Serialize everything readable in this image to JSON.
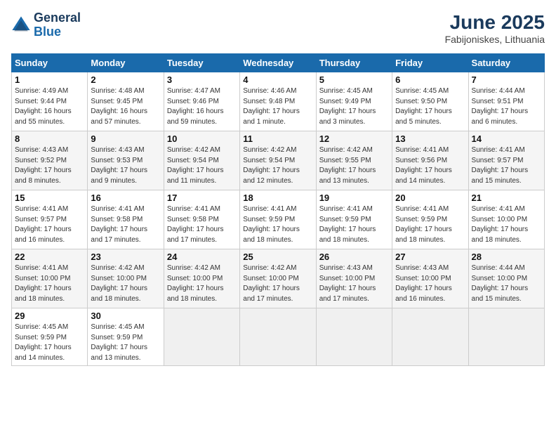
{
  "logo": {
    "general": "General",
    "blue": "Blue"
  },
  "title": "June 2025",
  "subtitle": "Fabijoniskes, Lithuania",
  "headers": [
    "Sunday",
    "Monday",
    "Tuesday",
    "Wednesday",
    "Thursday",
    "Friday",
    "Saturday"
  ],
  "weeks": [
    [
      {
        "day": "1",
        "info": "Sunrise: 4:49 AM\nSunset: 9:44 PM\nDaylight: 16 hours\nand 55 minutes."
      },
      {
        "day": "2",
        "info": "Sunrise: 4:48 AM\nSunset: 9:45 PM\nDaylight: 16 hours\nand 57 minutes."
      },
      {
        "day": "3",
        "info": "Sunrise: 4:47 AM\nSunset: 9:46 PM\nDaylight: 16 hours\nand 59 minutes."
      },
      {
        "day": "4",
        "info": "Sunrise: 4:46 AM\nSunset: 9:48 PM\nDaylight: 17 hours\nand 1 minute."
      },
      {
        "day": "5",
        "info": "Sunrise: 4:45 AM\nSunset: 9:49 PM\nDaylight: 17 hours\nand 3 minutes."
      },
      {
        "day": "6",
        "info": "Sunrise: 4:45 AM\nSunset: 9:50 PM\nDaylight: 17 hours\nand 5 minutes."
      },
      {
        "day": "7",
        "info": "Sunrise: 4:44 AM\nSunset: 9:51 PM\nDaylight: 17 hours\nand 6 minutes."
      }
    ],
    [
      {
        "day": "8",
        "info": "Sunrise: 4:43 AM\nSunset: 9:52 PM\nDaylight: 17 hours\nand 8 minutes."
      },
      {
        "day": "9",
        "info": "Sunrise: 4:43 AM\nSunset: 9:53 PM\nDaylight: 17 hours\nand 9 minutes."
      },
      {
        "day": "10",
        "info": "Sunrise: 4:42 AM\nSunset: 9:54 PM\nDaylight: 17 hours\nand 11 minutes."
      },
      {
        "day": "11",
        "info": "Sunrise: 4:42 AM\nSunset: 9:54 PM\nDaylight: 17 hours\nand 12 minutes."
      },
      {
        "day": "12",
        "info": "Sunrise: 4:42 AM\nSunset: 9:55 PM\nDaylight: 17 hours\nand 13 minutes."
      },
      {
        "day": "13",
        "info": "Sunrise: 4:41 AM\nSunset: 9:56 PM\nDaylight: 17 hours\nand 14 minutes."
      },
      {
        "day": "14",
        "info": "Sunrise: 4:41 AM\nSunset: 9:57 PM\nDaylight: 17 hours\nand 15 minutes."
      }
    ],
    [
      {
        "day": "15",
        "info": "Sunrise: 4:41 AM\nSunset: 9:57 PM\nDaylight: 17 hours\nand 16 minutes."
      },
      {
        "day": "16",
        "info": "Sunrise: 4:41 AM\nSunset: 9:58 PM\nDaylight: 17 hours\nand 17 minutes."
      },
      {
        "day": "17",
        "info": "Sunrise: 4:41 AM\nSunset: 9:58 PM\nDaylight: 17 hours\nand 17 minutes."
      },
      {
        "day": "18",
        "info": "Sunrise: 4:41 AM\nSunset: 9:59 PM\nDaylight: 17 hours\nand 18 minutes."
      },
      {
        "day": "19",
        "info": "Sunrise: 4:41 AM\nSunset: 9:59 PM\nDaylight: 17 hours\nand 18 minutes."
      },
      {
        "day": "20",
        "info": "Sunrise: 4:41 AM\nSunset: 9:59 PM\nDaylight: 17 hours\nand 18 minutes."
      },
      {
        "day": "21",
        "info": "Sunrise: 4:41 AM\nSunset: 10:00 PM\nDaylight: 17 hours\nand 18 minutes."
      }
    ],
    [
      {
        "day": "22",
        "info": "Sunrise: 4:41 AM\nSunset: 10:00 PM\nDaylight: 17 hours\nand 18 minutes."
      },
      {
        "day": "23",
        "info": "Sunrise: 4:42 AM\nSunset: 10:00 PM\nDaylight: 17 hours\nand 18 minutes."
      },
      {
        "day": "24",
        "info": "Sunrise: 4:42 AM\nSunset: 10:00 PM\nDaylight: 17 hours\nand 18 minutes."
      },
      {
        "day": "25",
        "info": "Sunrise: 4:42 AM\nSunset: 10:00 PM\nDaylight: 17 hours\nand 17 minutes."
      },
      {
        "day": "26",
        "info": "Sunrise: 4:43 AM\nSunset: 10:00 PM\nDaylight: 17 hours\nand 17 minutes."
      },
      {
        "day": "27",
        "info": "Sunrise: 4:43 AM\nSunset: 10:00 PM\nDaylight: 17 hours\nand 16 minutes."
      },
      {
        "day": "28",
        "info": "Sunrise: 4:44 AM\nSunset: 10:00 PM\nDaylight: 17 hours\nand 15 minutes."
      }
    ],
    [
      {
        "day": "29",
        "info": "Sunrise: 4:45 AM\nSunset: 9:59 PM\nDaylight: 17 hours\nand 14 minutes."
      },
      {
        "day": "30",
        "info": "Sunrise: 4:45 AM\nSunset: 9:59 PM\nDaylight: 17 hours\nand 13 minutes."
      },
      {
        "day": "",
        "info": "",
        "empty": true
      },
      {
        "day": "",
        "info": "",
        "empty": true
      },
      {
        "day": "",
        "info": "",
        "empty": true
      },
      {
        "day": "",
        "info": "",
        "empty": true
      },
      {
        "day": "",
        "info": "",
        "empty": true
      }
    ]
  ]
}
